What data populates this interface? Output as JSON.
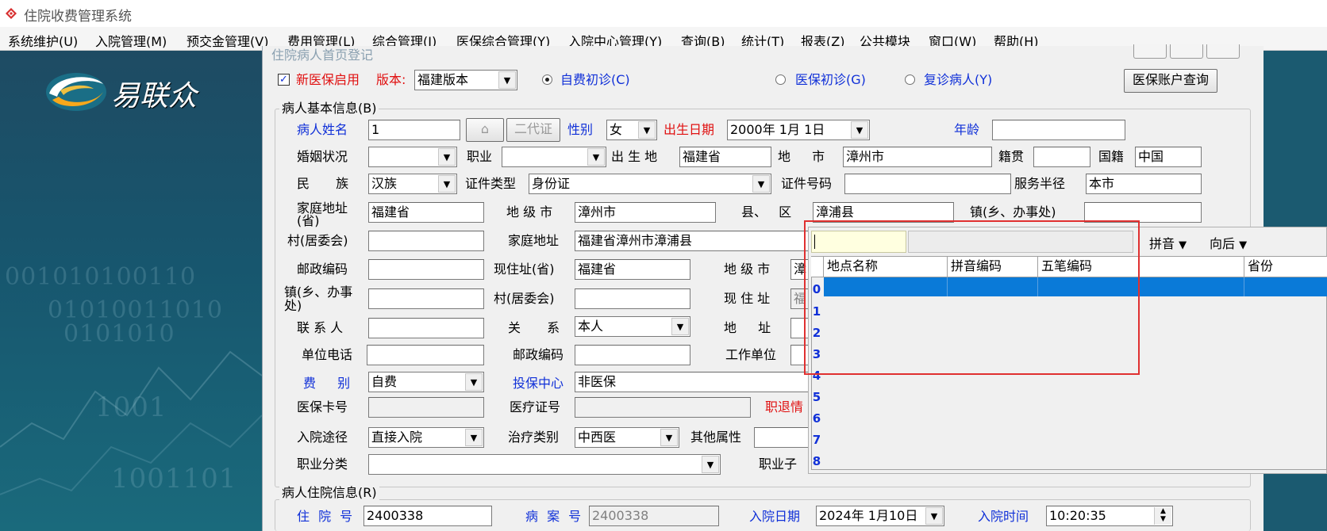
{
  "app": {
    "title": "住院收费管理系统"
  },
  "menu": [
    "系统维护(U)",
    "入院管理(M)",
    "预交金管理(V)",
    "费用管理(L)",
    "综合管理(J)",
    "医保综合管理(Y)",
    "入院中心管理(Y)",
    "查询(B)",
    "统计(T)",
    "报表(Z)",
    "公共模块",
    "窗口(W)",
    "帮助(H)"
  ],
  "brand": {
    "logo_text": "易联众",
    "binary_1": "001010100110",
    "binary_2": "01010011010",
    "binary_3": "0101010",
    "binary_4": "1001",
    "binary_5": "1001101"
  },
  "window": {
    "caption": "住院病人首页登记"
  },
  "top": {
    "new_insurance_label": "新医保启用",
    "version_label": "版本:",
    "version_value": "福建版本",
    "radio_self_pay": "自费初诊(C)",
    "radio_insurance": "医保初诊(G)",
    "radio_return": "复诊病人(Y)",
    "account_query_button": "医保账户查询"
  },
  "basic": {
    "group_title": "病人基本信息(B)",
    "name_label": "病人姓名",
    "name_value": "1",
    "id2_button": "二代证",
    "gender_label": "性别",
    "gender_value": "女",
    "birth_label": "出生日期",
    "birth_value": "2000年 1月 1日",
    "age_label": "年龄",
    "age_value": "",
    "marital_label": "婚姻状况",
    "marital_value": "",
    "job_label": "职业",
    "job_value": "",
    "birthplace_label": "出 生 地",
    "birthplace_prov": "福建省",
    "birthplace_city_label": "地 市",
    "birthplace_city": "漳州市",
    "native_label": "籍贯",
    "native_value": "",
    "nationality_label": "国籍",
    "nationality_value": "中国",
    "ethnic_label": "民 族",
    "ethnic_value": "汉族",
    "idtype_label": "证件类型",
    "idtype_value": "身份证",
    "idno_label": "证件号码",
    "idno_value": "",
    "radius_label": "服务半径",
    "radius_value": "本市",
    "home_prov_label": "家庭地址(省)",
    "home_prov": "福建省",
    "home_city_label": "地 级 市",
    "home_city": "漳州市",
    "county_label": "县、 区",
    "county_value": "漳浦县",
    "town_label": "镇(乡、办事处)",
    "town_value": "",
    "village_label": "村(居委会)",
    "village_value": "",
    "home_addr_label": "家庭地址",
    "home_addr": "福建省漳州市漳浦县",
    "postcode_label": "邮政编码",
    "postcode_value": "",
    "cur_prov_label": "现住址(省)",
    "cur_prov": "福建省",
    "cur_city_label": "地 级 市",
    "cur_city": "漳",
    "cur_town_label": "镇(乡、办事处)",
    "cur_town": "",
    "cur_village_label": "村(居委会)",
    "cur_village": "",
    "cur_addr_label": "现 住 址",
    "cur_addr": "福",
    "contact_label": "联 系 人",
    "contact_value": "",
    "relation_label": "关 系",
    "relation_value": "本人",
    "address_label": "地 址",
    "address_value": "",
    "unit_phone_label": "单位电话",
    "unit_phone": "",
    "postcode2_label": "邮政编码",
    "postcode2_value": "",
    "workplace_label": "工作单位",
    "workplace_value": "",
    "fee_label": "费 别",
    "fee_value": "自费",
    "insure_center_label": "投保中心",
    "insure_center": "非医保",
    "card_label": "医保卡号",
    "card_value": "",
    "medcert_label": "医疗证号",
    "medcert_value": "",
    "refund_label": "职退情",
    "route_label": "入院途径",
    "route_value": "直接入院",
    "treat_label": "治疗类别",
    "treat_value": "中西医",
    "other_label": "其他属性",
    "other_value": "",
    "jobclass_label": "职业分类",
    "jobclass_value": "",
    "jobsub_label": "职业子"
  },
  "hosp": {
    "group_title": "病人住院信息(R)",
    "no_label": "住 院 号",
    "no_value": "2400338",
    "case_label": "病 案 号",
    "case_value": "2400338",
    "date_label": "入院日期",
    "date_value": "2024年 1月10日",
    "time_label": "入院时间",
    "time_value": "10:20:35"
  },
  "popup": {
    "pinyin_label": "拼音",
    "direction_label": "向后",
    "columns": [
      "地点名称",
      "拼音编码",
      "五笔编码",
      "省份"
    ],
    "row_numbers": [
      "0",
      "1",
      "2",
      "3",
      "4",
      "5",
      "6",
      "7",
      "8"
    ]
  }
}
